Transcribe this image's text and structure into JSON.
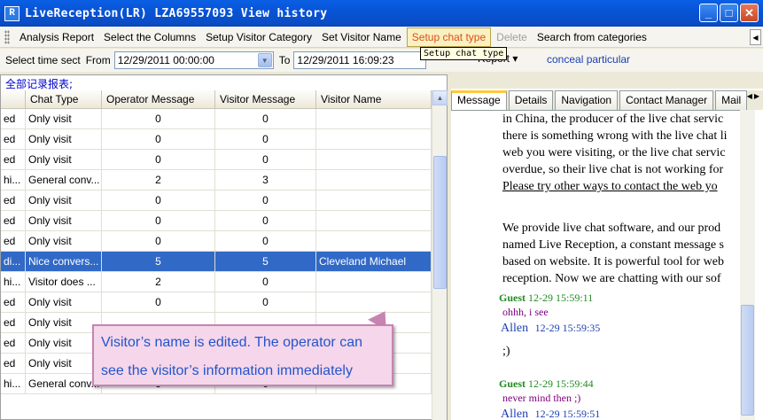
{
  "window": {
    "app_icon": "R",
    "title": "LiveReception(LR) LZA69557093  View history",
    "minimize_icon": "_",
    "maximize_icon": "□",
    "close_icon": "✕"
  },
  "menu": {
    "items": [
      "Analysis Report",
      "Select the Columns",
      "Setup Visitor Category",
      "Set Visitor Name",
      "Setup chat type",
      "Delete",
      "Search from categories"
    ],
    "active_index": 4,
    "disabled_index": 5
  },
  "tooltip": "Setup chat type",
  "filter": {
    "select_time_label": "Select time sect",
    "from_label": "From",
    "from_value": "12/29/2011 00:00:00",
    "to_label": "To",
    "to_value": "12/29/2011 16:09:23",
    "report_label": "Report ▾",
    "conceal_label": "conceal particular"
  },
  "report_title": "全部记录报表;",
  "grid": {
    "columns": [
      "",
      "Chat Type",
      "Operator Message",
      "Visitor Message",
      "Visitor Name"
    ],
    "rows": [
      {
        "c0": "ed",
        "type": "Only visit",
        "op": "0",
        "vis": "0",
        "name": ""
      },
      {
        "c0": "ed",
        "type": "Only visit",
        "op": "0",
        "vis": "0",
        "name": ""
      },
      {
        "c0": "ed",
        "type": "Only visit",
        "op": "0",
        "vis": "0",
        "name": ""
      },
      {
        "c0": "hi...",
        "type": "General conv...",
        "op": "2",
        "vis": "3",
        "name": ""
      },
      {
        "c0": "ed",
        "type": "Only visit",
        "op": "0",
        "vis": "0",
        "name": ""
      },
      {
        "c0": "ed",
        "type": "Only visit",
        "op": "0",
        "vis": "0",
        "name": ""
      },
      {
        "c0": "ed",
        "type": "Only visit",
        "op": "0",
        "vis": "0",
        "name": ""
      },
      {
        "c0": "di...",
        "type": "Nice convers...",
        "op": "5",
        "vis": "5",
        "name": "Cleveland Michael"
      },
      {
        "c0": "hi...",
        "type": "Visitor does ...",
        "op": "2",
        "vis": "0",
        "name": ""
      },
      {
        "c0": "ed",
        "type": "Only visit",
        "op": "0",
        "vis": "0",
        "name": ""
      },
      {
        "c0": "ed",
        "type": "Only visit",
        "op": "",
        "vis": "",
        "name": ""
      },
      {
        "c0": "ed",
        "type": "Only visit",
        "op": "",
        "vis": "",
        "name": ""
      },
      {
        "c0": "ed",
        "type": "Only visit",
        "op": "0",
        "vis": "0",
        "name": ""
      },
      {
        "c0": "hi...",
        "type": "General conv...",
        "op": "3",
        "vis": "6",
        "name": ""
      }
    ],
    "selected_index": 7
  },
  "callout": {
    "line1": "Visitor’s name is edited. The operator can",
    "line2": "see the visitor’s information immediately"
  },
  "tabs": [
    "Message",
    "Details",
    "Navigation",
    "Contact Manager",
    "Mail"
  ],
  "message": {
    "p1": [
      "in China, the producer of the live chat servic",
      "there is something wrong with the live chat li",
      "web you were visiting, or the live chat servic",
      "overdue, so their live chat is not working for",
      "Please try other ways to contact the web yo"
    ],
    "p2": [
      "We provide live chat software, and our prod",
      "named Live Reception, a constant message s",
      "based on website. It is powerful tool for web",
      "reception. Now we are chatting with our sof"
    ],
    "chats": [
      {
        "who": "Guest",
        "time": "12-29 15:59:11",
        "text": "ohhh, i see",
        "kind": "guest"
      },
      {
        "who": "Allen",
        "time": "12-29 15:59:35",
        "text": ";)",
        "kind": "op"
      },
      {
        "who": "Guest",
        "time": "12-29 15:59:44",
        "text": "never mind then ;)",
        "kind": "guest"
      },
      {
        "who": "Allen",
        "time": "12-29 15:59:51",
        "text": "",
        "kind": "op"
      }
    ]
  }
}
